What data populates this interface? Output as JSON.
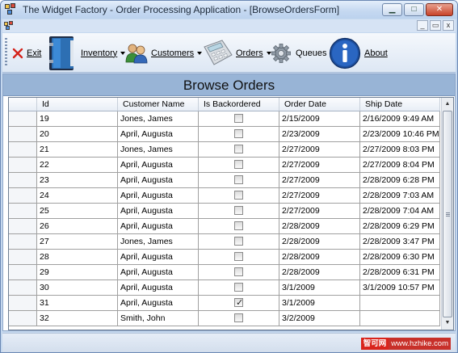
{
  "window": {
    "title": "The Widget Factory - Order Processing Application - [BrowseOrdersForm]",
    "caption_minimize": "▁",
    "caption_maximize": "□",
    "caption_close": "✕"
  },
  "mdi": {
    "minimize": "_",
    "restore": "▭",
    "close": "x"
  },
  "toolbar": {
    "exit_label": "Exit",
    "inventory_label": "Inventory",
    "customers_label": "Customers",
    "orders_label": "Orders",
    "queues_label": "Queues",
    "about_label": "About"
  },
  "page": {
    "heading": "Browse Orders"
  },
  "grid": {
    "columns": [
      "Id",
      "Customer Name",
      "Is Backordered",
      "Order Date",
      "Ship Date"
    ],
    "rows": [
      {
        "id": "19",
        "name": "Jones, James",
        "backordered": false,
        "order_date": "2/15/2009",
        "ship_date": "2/16/2009 9:49 AM"
      },
      {
        "id": "20",
        "name": "April, Augusta",
        "backordered": false,
        "order_date": "2/23/2009",
        "ship_date": "2/23/2009 10:46 PM"
      },
      {
        "id": "21",
        "name": "Jones, James",
        "backordered": false,
        "order_date": "2/27/2009",
        "ship_date": "2/27/2009 8:03 PM"
      },
      {
        "id": "22",
        "name": "April, Augusta",
        "backordered": false,
        "order_date": "2/27/2009",
        "ship_date": "2/27/2009 8:04 PM"
      },
      {
        "id": "23",
        "name": "April, Augusta",
        "backordered": false,
        "order_date": "2/27/2009",
        "ship_date": "2/28/2009 6:28 PM"
      },
      {
        "id": "24",
        "name": "April, Augusta",
        "backordered": false,
        "order_date": "2/27/2009",
        "ship_date": "2/28/2009 7:03 AM"
      },
      {
        "id": "25",
        "name": "April, Augusta",
        "backordered": false,
        "order_date": "2/27/2009",
        "ship_date": "2/28/2009 7:04 AM"
      },
      {
        "id": "26",
        "name": "April, Augusta",
        "backordered": false,
        "order_date": "2/28/2009",
        "ship_date": "2/28/2009 6:29 PM"
      },
      {
        "id": "27",
        "name": "Jones, James",
        "backordered": false,
        "order_date": "2/28/2009",
        "ship_date": "2/28/2009 3:47 PM"
      },
      {
        "id": "28",
        "name": "April, Augusta",
        "backordered": false,
        "order_date": "2/28/2009",
        "ship_date": "2/28/2009 6:30 PM"
      },
      {
        "id": "29",
        "name": "April, Augusta",
        "backordered": false,
        "order_date": "2/28/2009",
        "ship_date": "2/28/2009 6:31 PM"
      },
      {
        "id": "30",
        "name": "April, Augusta",
        "backordered": false,
        "order_date": "3/1/2009",
        "ship_date": "3/1/2009 10:57 PM"
      },
      {
        "id": "31",
        "name": "April, Augusta",
        "backordered": true,
        "order_date": "3/1/2009",
        "ship_date": ""
      },
      {
        "id": "32",
        "name": "Smith, John",
        "backordered": false,
        "order_date": "3/2/2009",
        "ship_date": ""
      }
    ]
  },
  "scrollbar": {
    "up": "▲",
    "down": "▼"
  },
  "watermark": {
    "brand": "智可网",
    "url": "www.hzhike.com"
  },
  "icons": {
    "app": "widget-factory-icon",
    "exit": "red-x-icon",
    "inventory": "blue-binder-icon",
    "customers": "users-icon",
    "orders": "calculator-icon",
    "queues": "gear-icon",
    "about": "info-icon"
  }
}
